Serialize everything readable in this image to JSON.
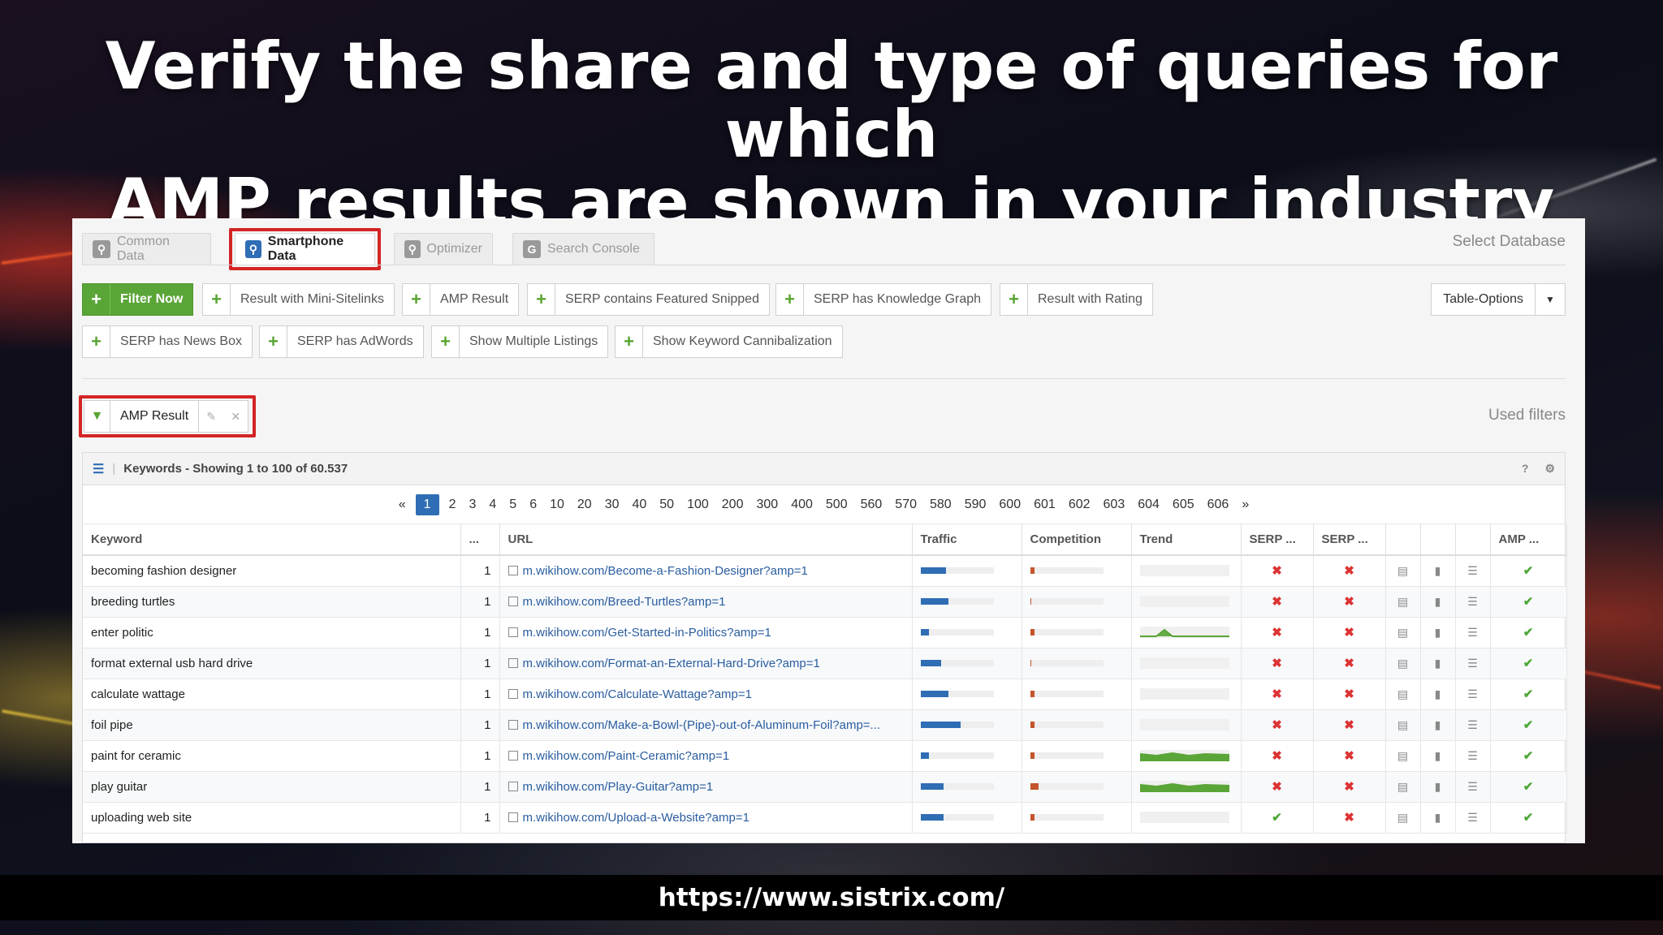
{
  "slide": {
    "title_line1": "Verify the share and type of queries for which",
    "title_line2": "AMP results are shown in your industry",
    "footer_url": "https://www.sistrix.com/"
  },
  "tabs": [
    {
      "label": "Common Data",
      "icon": "search-icon",
      "active": false
    },
    {
      "label": "Smartphone Data",
      "icon": "search-icon",
      "active": true
    },
    {
      "label": "Optimizer",
      "icon": "search-icon",
      "active": false
    },
    {
      "label": "Search Console",
      "icon": "google-icon",
      "active": false
    }
  ],
  "select_database": "Select Database",
  "filter_buttons_row1": [
    "Filter Now",
    "Result with Mini-Sitelinks",
    "AMP Result",
    "SERP contains Featured Snipped",
    "SERP has Knowledge Graph",
    "Result with Rating"
  ],
  "filter_buttons_row2": [
    "SERP has News Box",
    "SERP has AdWords",
    "Show Multiple Listings",
    "Show Keyword Cannibalization"
  ],
  "table_options": "Table-Options",
  "used_filters": "Used filters",
  "active_filter": "AMP Result",
  "panel_title": "Keywords - Showing 1 to 100 of 60.537",
  "panel_help": "?",
  "pager": [
    "«",
    "1",
    "2",
    "3",
    "4",
    "5",
    "6",
    "10",
    "20",
    "30",
    "40",
    "50",
    "100",
    "200",
    "300",
    "400",
    "500",
    "560",
    "570",
    "580",
    "590",
    "600",
    "601",
    "602",
    "603",
    "604",
    "605",
    "606",
    "»"
  ],
  "current_page": "1",
  "columns": [
    "Keyword",
    "...",
    "URL",
    "Traffic",
    "Competition",
    "Trend",
    "SERP ...",
    "SERP ...",
    "",
    "",
    "",
    "AMP ..."
  ],
  "rows": [
    {
      "keyword": "becoming fashion designer",
      "pos": "1",
      "domain": "m.wikihow.com",
      "path": "/Become-a-Fashion-Designer?amp=1",
      "traffic": 0.35,
      "competition": 0.06,
      "trend": "flat",
      "serp1": false,
      "serp2": false,
      "amp": true
    },
    {
      "keyword": "breeding turtles",
      "pos": "1",
      "domain": "m.wikihow.com",
      "path": "/Breed-Turtles?amp=1",
      "traffic": 0.38,
      "competition": 0.02,
      "trend": "flat",
      "serp1": false,
      "serp2": false,
      "amp": true
    },
    {
      "keyword": "enter politic",
      "pos": "1",
      "domain": "m.wikihow.com",
      "path": "/Get-Started-in-Politics?amp=1",
      "traffic": 0.12,
      "competition": 0.06,
      "trend": "peak",
      "serp1": false,
      "serp2": false,
      "amp": true
    },
    {
      "keyword": "format external usb hard drive",
      "pos": "1",
      "domain": "m.wikihow.com",
      "path": "/Format-an-External-Hard-Drive?amp=1",
      "traffic": 0.28,
      "competition": 0.02,
      "trend": "flat",
      "serp1": false,
      "serp2": false,
      "amp": true
    },
    {
      "keyword": "calculate wattage",
      "pos": "1",
      "domain": "m.wikihow.com",
      "path": "/Calculate-Wattage?amp=1",
      "traffic": 0.38,
      "competition": 0.06,
      "trend": "flat",
      "serp1": false,
      "serp2": false,
      "amp": true
    },
    {
      "keyword": "foil pipe",
      "pos": "1",
      "domain": "m.wikihow.com",
      "path": "/Make-a-Bowl-(Pipe)-out-of-Aluminum-Foil?amp=...",
      "traffic": 0.55,
      "competition": 0.06,
      "trend": "flat",
      "serp1": false,
      "serp2": false,
      "amp": true
    },
    {
      "keyword": "paint for ceramic",
      "pos": "1",
      "domain": "m.wikihow.com",
      "path": "/Paint-Ceramic?amp=1",
      "traffic": 0.12,
      "competition": 0.06,
      "trend": "full",
      "serp1": false,
      "serp2": false,
      "amp": true
    },
    {
      "keyword": "play guitar",
      "pos": "1",
      "domain": "m.wikihow.com",
      "path": "/Play-Guitar?amp=1",
      "traffic": 0.32,
      "competition": 0.12,
      "trend": "full",
      "serp1": false,
      "serp2": false,
      "amp": true
    },
    {
      "keyword": "uploading web site",
      "pos": "1",
      "domain": "m.wikihow.com",
      "path": "/Upload-a-Website?amp=1",
      "traffic": 0.32,
      "competition": 0.06,
      "trend": "flat",
      "serp1": true,
      "serp2": false,
      "amp": true
    }
  ],
  "colors": {
    "accent": "#2f6db5",
    "green": "#5aa537",
    "red_highlight": "#d42424",
    "competition": "#c4542c"
  }
}
